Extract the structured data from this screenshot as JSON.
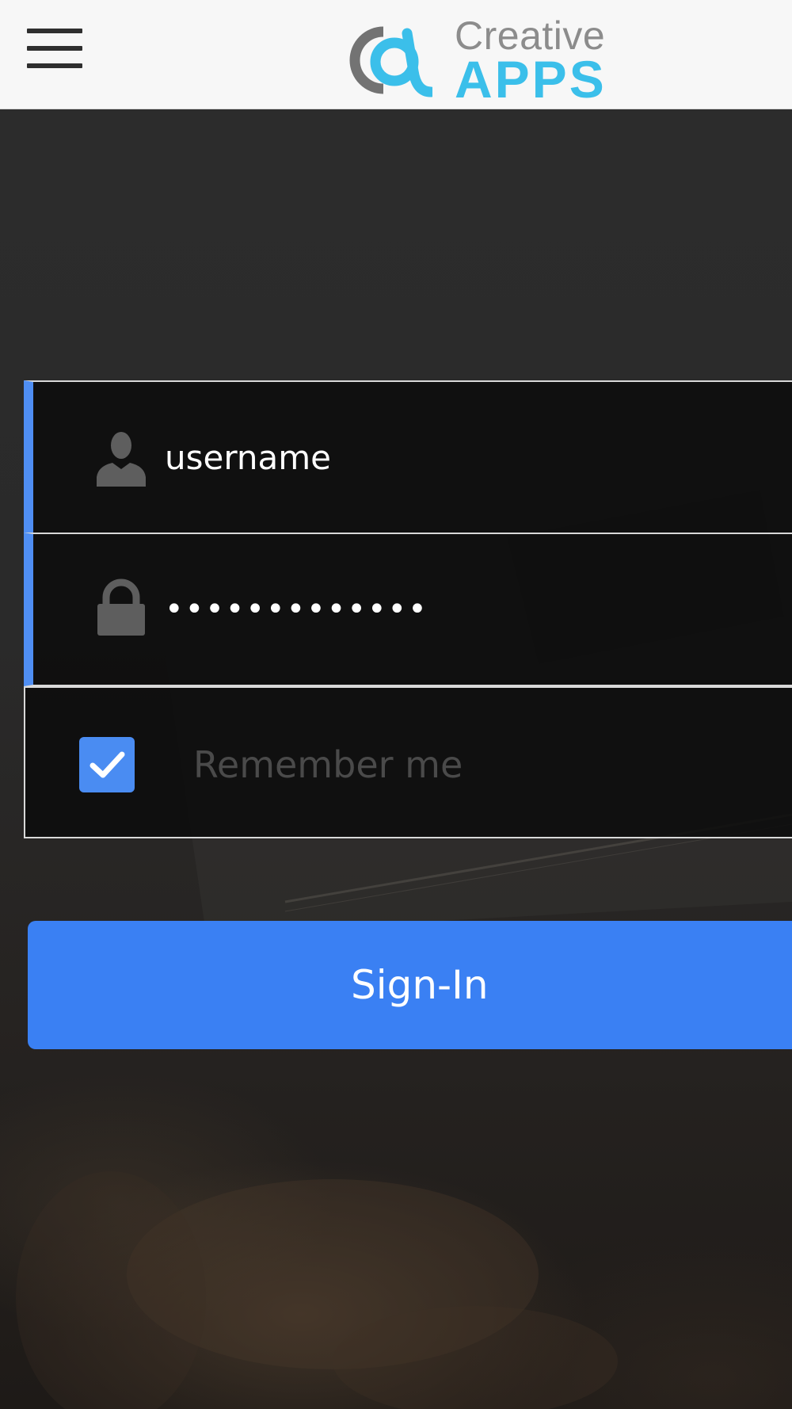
{
  "app": {
    "logo_word1": "Creative",
    "logo_word2": "APPS",
    "brand_color": "#3bbfea",
    "logo_gray": "#737373"
  },
  "header": {
    "menu_icon": "hamburger-menu-icon"
  },
  "login": {
    "username": {
      "icon": "user-icon",
      "placeholder": "username",
      "value": ""
    },
    "password": {
      "icon": "lock-icon",
      "value": "•••••••••••••"
    },
    "remember": {
      "label": "Remember me",
      "checked": true,
      "icon": "checkmark-icon"
    },
    "signin_label": "Sign-In"
  },
  "colors": {
    "accent": "#4a8cf2",
    "button": "#3a80f3",
    "header_bg": "#f7f7f7"
  }
}
